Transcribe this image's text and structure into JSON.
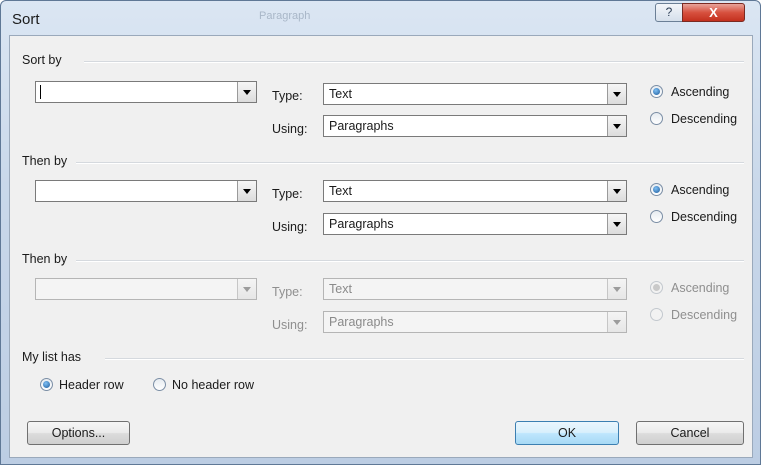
{
  "window": {
    "title": "Sort",
    "ghost_title": "Paragraph",
    "help_glyph": "?",
    "close_glyph": "X"
  },
  "sections": [
    {
      "label": "Sort by",
      "key_value": "",
      "type_label": "Type:",
      "type_value": "Text",
      "using_label": "Using:",
      "using_value": "Paragraphs",
      "ascending_label": "Ascending",
      "descending_label": "Descending",
      "selected": "ascending",
      "enabled": true
    },
    {
      "label": "Then by",
      "key_value": "",
      "type_label": "Type:",
      "type_value": "Text",
      "using_label": "Using:",
      "using_value": "Paragraphs",
      "ascending_label": "Ascending",
      "descending_label": "Descending",
      "selected": "ascending",
      "enabled": true
    },
    {
      "label": "Then by",
      "key_value": "",
      "type_label": "Type:",
      "type_value": "Text",
      "using_label": "Using:",
      "using_value": "Paragraphs",
      "ascending_label": "Ascending",
      "descending_label": "Descending",
      "selected": "ascending",
      "enabled": false
    }
  ],
  "list_has": {
    "label": "My list has",
    "header_row": "Header row",
    "no_header_row": "No header row",
    "selected": "header_row"
  },
  "buttons": {
    "options": "Options...",
    "ok": "OK",
    "cancel": "Cancel"
  }
}
